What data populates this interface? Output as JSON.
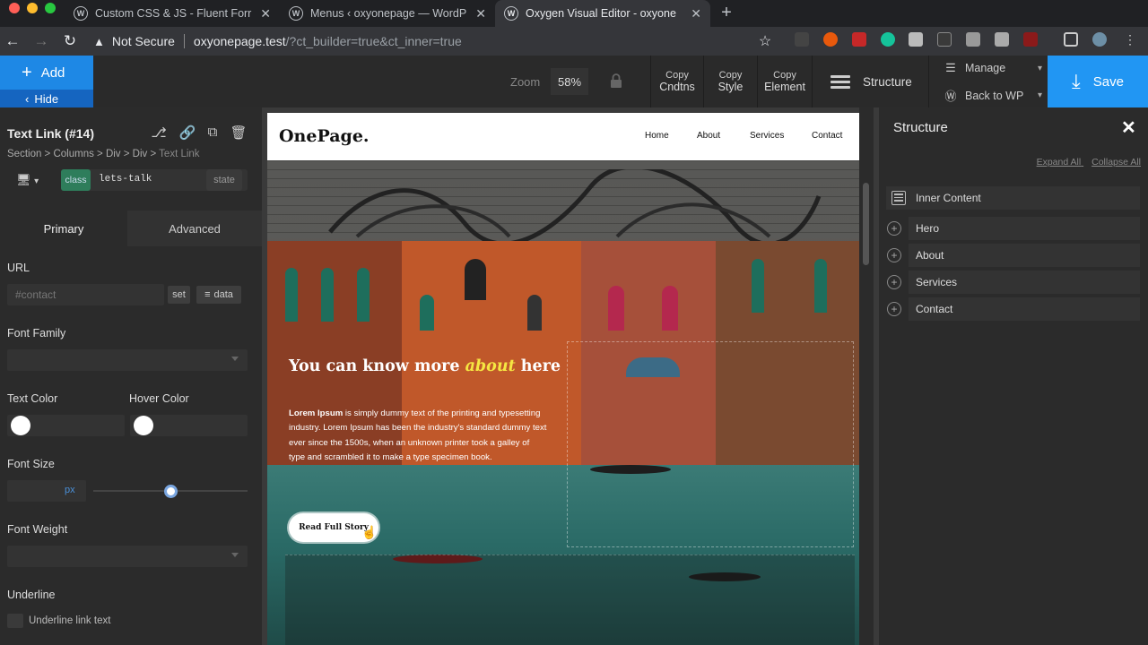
{
  "browser": {
    "tabs": [
      {
        "title": "Custom CSS & JS - Fluent Forr",
        "active": false
      },
      {
        "title": "Menus ‹ oxyonepage — WordP",
        "active": false
      },
      {
        "title": "Oxygen Visual Editor - oxyone",
        "active": true
      }
    ],
    "security": "Not Secure",
    "url_host": "oxyonepage.test",
    "url_path": "/?ct_builder=true&ct_inner=true"
  },
  "toolbar": {
    "add_label": "Add",
    "hide_label": "Hide",
    "zoom_label": "Zoom",
    "zoom_value": "58%",
    "copy_conditions": [
      "Copy",
      "Cndtns"
    ],
    "copy_style": [
      "Copy",
      "Style"
    ],
    "copy_element": [
      "Copy",
      "Element"
    ],
    "structure_label": "Structure",
    "manage_label": "Manage",
    "back_to_wp_label": "Back to WP",
    "save_label": "Save"
  },
  "left_panel": {
    "element_title": "Text Link (#14)",
    "breadcrumb": "Section > Columns > Div > Div > ",
    "breadcrumb_current": "Text Link",
    "class_badge": "class",
    "class_name": "lets-talk",
    "state_label": "state",
    "tab_primary": "Primary",
    "tab_advanced": "Advanced",
    "url_label": "URL",
    "url_placeholder": "#contact",
    "set_label": "set",
    "data_label": "data",
    "font_family_label": "Font Family",
    "text_color_label": "Text Color",
    "hover_color_label": "Hover Color",
    "font_size_label": "Font Size",
    "font_size_unit": "px",
    "font_weight_label": "Font Weight",
    "underline_label": "Underline",
    "underline_checkbox_label": "Underline link text"
  },
  "site": {
    "logo": "OnePage.",
    "nav": [
      "Home",
      "About",
      "Services",
      "Contact"
    ],
    "hero_title_pre": "You can know more ",
    "hero_title_highlight": "about",
    "hero_title_post": " here",
    "hero_desc_bold": "Lorem Ipsum",
    "hero_desc_rest": " is simply dummy text of the printing and typesetting industry. Lorem Ipsum has been the industry's standard dummy text ever since the 1500s, when an unknown printer took a galley of type and scrambled it to make a type specimen book.",
    "hero_button": "Read Full Story"
  },
  "right_panel": {
    "title": "Structure",
    "expand_all": "Expand All",
    "collapse_all": "Collapse All",
    "root": "Inner Content",
    "items": [
      "Hero",
      "About",
      "Services",
      "Contact"
    ]
  },
  "colors": {
    "accent_blue": "#1e88e5",
    "save_blue": "#2196f3",
    "class_green": "#2e7d5b",
    "hero_highlight": "#f5e642"
  }
}
